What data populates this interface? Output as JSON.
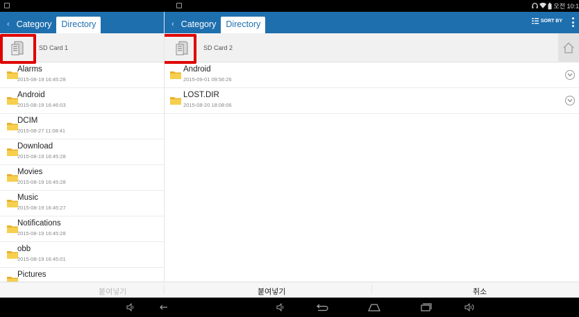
{
  "status_bar": {
    "time": "오전 10:1"
  },
  "left_pane": {
    "tabs": [
      {
        "label": "Category"
      },
      {
        "label": "Directory"
      }
    ],
    "path_label": "SD Card 1",
    "files": [
      {
        "name": "Alarms",
        "date": "2015-08-19 16:45:28"
      },
      {
        "name": "Android",
        "date": "2015-08-19 16:46:03"
      },
      {
        "name": "DCIM",
        "date": "2015-08-27 11:08:41"
      },
      {
        "name": "Download",
        "date": "2015-08-19 16:45:28"
      },
      {
        "name": "Movies",
        "date": "2015-08-19 16:45:28"
      },
      {
        "name": "Music",
        "date": "2015-08-19 16:45:27"
      },
      {
        "name": "Notifications",
        "date": "2015-08-19 16:45:28"
      },
      {
        "name": "obb",
        "date": "2015-08-19 16:45:01"
      },
      {
        "name": "Pictures",
        "date": ""
      }
    ]
  },
  "right_pane": {
    "tabs": [
      {
        "label": "Category"
      },
      {
        "label": "Directory"
      }
    ],
    "sort_label": "SORT BY",
    "path_label": "SD Card 2",
    "files": [
      {
        "name": "Android",
        "date": "2015-09-01 09:56:26"
      },
      {
        "name": "LOST.DIR",
        "date": "2015-08-20 18:08:06"
      }
    ]
  },
  "action_bar": {
    "left_paste_label": "붙여넣기",
    "paste_label": "붙여넣기",
    "cancel_label": "취소"
  },
  "colors": {
    "accent": "#1e6fae",
    "highlight": "#e00000",
    "folder": "#f4c542"
  }
}
